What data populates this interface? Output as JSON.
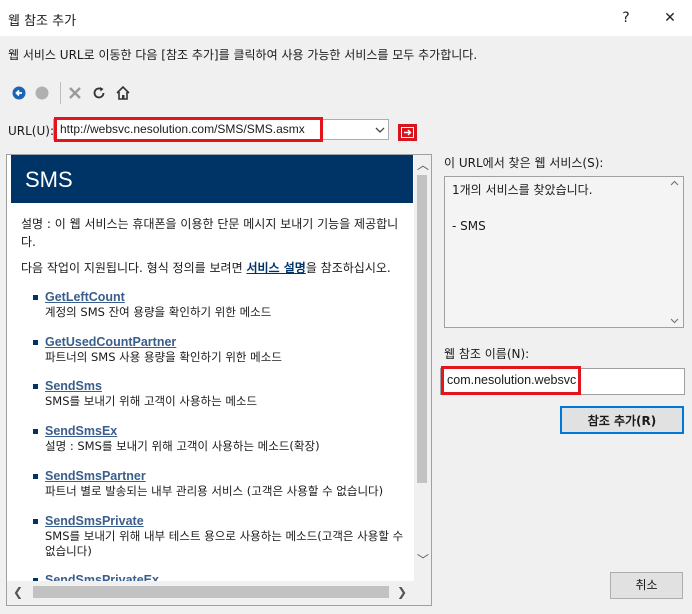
{
  "window": {
    "title": "웹 참조 추가",
    "help_label": "?",
    "close_label": "✕"
  },
  "instruction": "웹 서비스 URL로 이동한 다음 [참조 추가]를 클릭하여 사용 가능한 서비스를 모두 추가합니다.",
  "toolbar": {
    "icons": [
      "back-icon",
      "stop-icon",
      "delete-icon",
      "refresh-icon",
      "home-icon"
    ]
  },
  "url": {
    "label": "URL(U):",
    "value": "http://websvc.nesolution.com/SMS/SMS.asmx"
  },
  "browser": {
    "service_title": "SMS",
    "description": "설명 : 이 웹 서비스는 휴대폰을 이용한 단문 메시지 보내기 기능을 제공합니다.",
    "ops_intro_before": "다음 작업이 지원됩니다. 형식 정의를 보려면 ",
    "ops_link": "서비스 설명",
    "ops_intro_after": "을 참조하십시오.",
    "operations": [
      {
        "name": "GetLeftCount",
        "desc": "계정의 SMS 잔여 용량을 확인하기 위한 메소드"
      },
      {
        "name": "GetUsedCountPartner",
        "desc": "파트너의 SMS 사용 용량을 확인하기 위한 메소드"
      },
      {
        "name": "SendSms",
        "desc": "SMS를 보내기 위해 고객이 사용하는 메소드"
      },
      {
        "name": "SendSmsEx",
        "desc": "설명 : SMS를 보내기 위해 고객이 사용하는 메소드(확장)"
      },
      {
        "name": "SendSmsPartner",
        "desc": "파트너 별로 발송되는 내부 관리용 서비스 (고객은 사용할 수 없습니다)"
      },
      {
        "name": "SendSmsPrivate",
        "desc": "SMS를 보내기 위해 내부 테스트 용으로 사용하는 메소드(고객은 사용할 수 없습니다)"
      },
      {
        "name": "SendSmsPrivateEx",
        "desc": ""
      }
    ]
  },
  "services_panel": {
    "label": "이 URL에서 찾은 웹 서비스(S):",
    "text": "1개의 서비스를 찾았습니다.\n\n- SMS"
  },
  "reference_name": {
    "label": "웹 참조 이름(N):",
    "value": "com.nesolution.websvc"
  },
  "buttons": {
    "add_reference": "참조 추가(R)",
    "cancel": "취소"
  },
  "colors": {
    "accent_red": "#e2151d",
    "header_blue": "#003366",
    "focus_blue": "#0078d7"
  }
}
